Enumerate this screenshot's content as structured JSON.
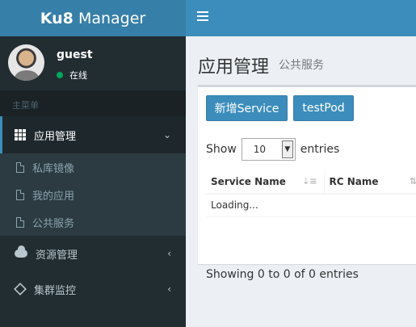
{
  "header": {
    "logo_bold": "Ku8",
    "logo_rest": " Manager"
  },
  "user": {
    "name": "guest",
    "status": "在线"
  },
  "sidebar": {
    "header": "主菜单",
    "items": [
      {
        "label": "应用管理",
        "icon": "grid-icon",
        "arrow": "⌄"
      },
      {
        "label": "资源管理",
        "icon": "cloud-icon",
        "arrow": "‹"
      },
      {
        "label": "集群监控",
        "icon": "cube-icon",
        "arrow": "‹"
      }
    ],
    "submenu": [
      {
        "label": "私库镜像"
      },
      {
        "label": "我的应用"
      },
      {
        "label": "公共服务"
      }
    ]
  },
  "page": {
    "title": "应用管理",
    "subtitle": "公共服务"
  },
  "toolbar": {
    "add_label": "新增Service",
    "test_label": "testPod"
  },
  "datatable": {
    "show_label": "Show",
    "page_size": "10",
    "entries_label": "entries",
    "columns": [
      "Service Name",
      "RC Name"
    ],
    "loading": "Loading...",
    "info": "Showing 0 to 0 of 0 entries"
  },
  "colors": {
    "header": "#3c8dbc",
    "logo_bg": "#367fa9",
    "sidebar": "#222d32",
    "status_online": "#00a65a"
  }
}
